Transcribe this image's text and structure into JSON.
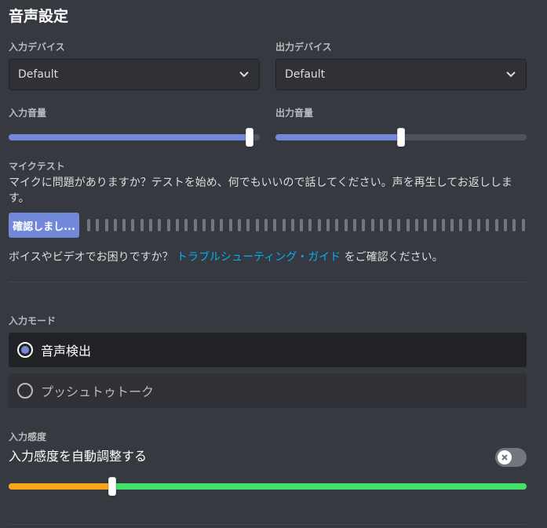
{
  "page": {
    "title": "音声設定"
  },
  "input_device": {
    "label": "入力デバイス",
    "value": "Default"
  },
  "output_device": {
    "label": "出力デバイス",
    "value": "Default"
  },
  "input_volume": {
    "label": "入力音量",
    "level": 0.96
  },
  "output_volume": {
    "label": "出力音量",
    "level": 0.5
  },
  "mic_test": {
    "label": "マイクテスト",
    "description": "マイクに問題がありますか？テストを始め、何でもいいので話してください。声を再生してお返しします。",
    "button_label": "確認しまし...",
    "meter_bar_count": 50
  },
  "help": {
    "prefix": "ボイスやビデオでお困りですか？",
    "link_text": "トラブルシューティング・ガイド",
    "suffix": "をご確認ください。"
  },
  "input_mode": {
    "label": "入力モード",
    "options": [
      {
        "label": "音声検出",
        "selected": true
      },
      {
        "label": "プッシュトゥトーク",
        "selected": false
      }
    ]
  },
  "sensitivity": {
    "label": "入力感度",
    "auto_label": "入力感度を自動調整する",
    "auto_enabled": false,
    "threshold": 0.2
  },
  "colors": {
    "accent": "#7289da",
    "link": "#00b0f4",
    "sensitivity_low": "#faa61a",
    "sensitivity_high": "#43e06a",
    "background": "#36393f"
  },
  "icons": {
    "dropdown": "chevron-down-icon",
    "toggle_off": "close-icon"
  }
}
